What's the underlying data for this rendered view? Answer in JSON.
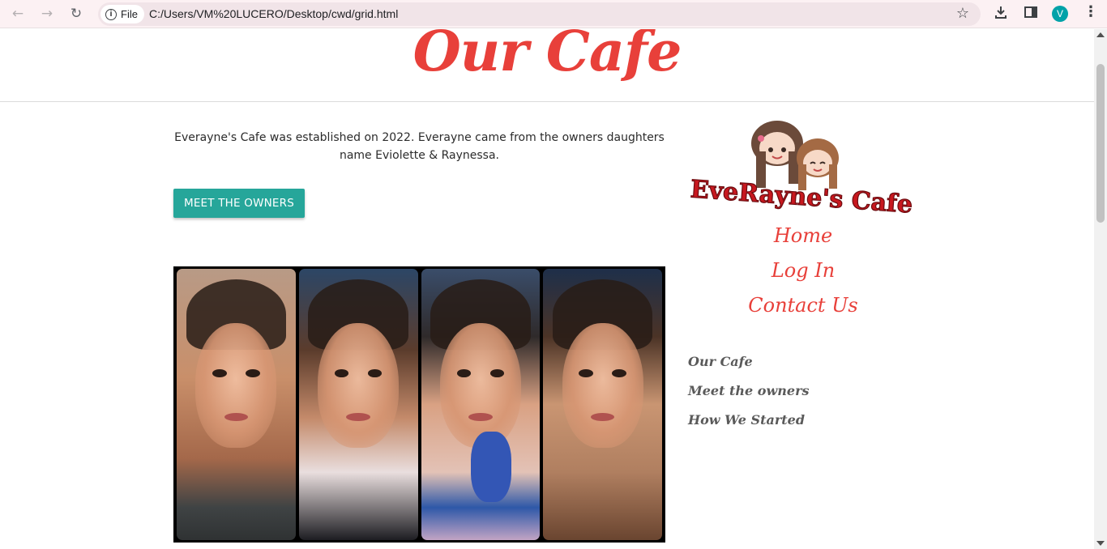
{
  "browser": {
    "protocol_label": "File",
    "url": "C:/Users/VM%20LUCERO/Desktop/cwd/grid.html",
    "profile_initial": "V",
    "icons": [
      "back-arrow-icon",
      "forward-arrow-icon",
      "reload-icon",
      "info-icon",
      "star-icon",
      "download-icon",
      "side-panel-icon",
      "kebab-menu-icon"
    ]
  },
  "header": {
    "title": "Our Cafe"
  },
  "main": {
    "intro_text": "Everayne's Cafe was established on 2022. Everayne came from the owners daughters name Eviolette & Raynessa.",
    "owners_button_label": "MEET THE OWNERS"
  },
  "sidebar": {
    "logo_text": "EveRayne's Cafe",
    "nav": [
      {
        "label": "Home"
      },
      {
        "label": "Log In"
      },
      {
        "label": "Contact Us"
      }
    ],
    "links": [
      {
        "label": "Our Cafe"
      },
      {
        "label": "Meet the owners"
      },
      {
        "label": "How We Started"
      }
    ]
  },
  "colors": {
    "accent": "#e8403a",
    "button": "#26a69a",
    "link_gray": "#5a5a5a"
  }
}
